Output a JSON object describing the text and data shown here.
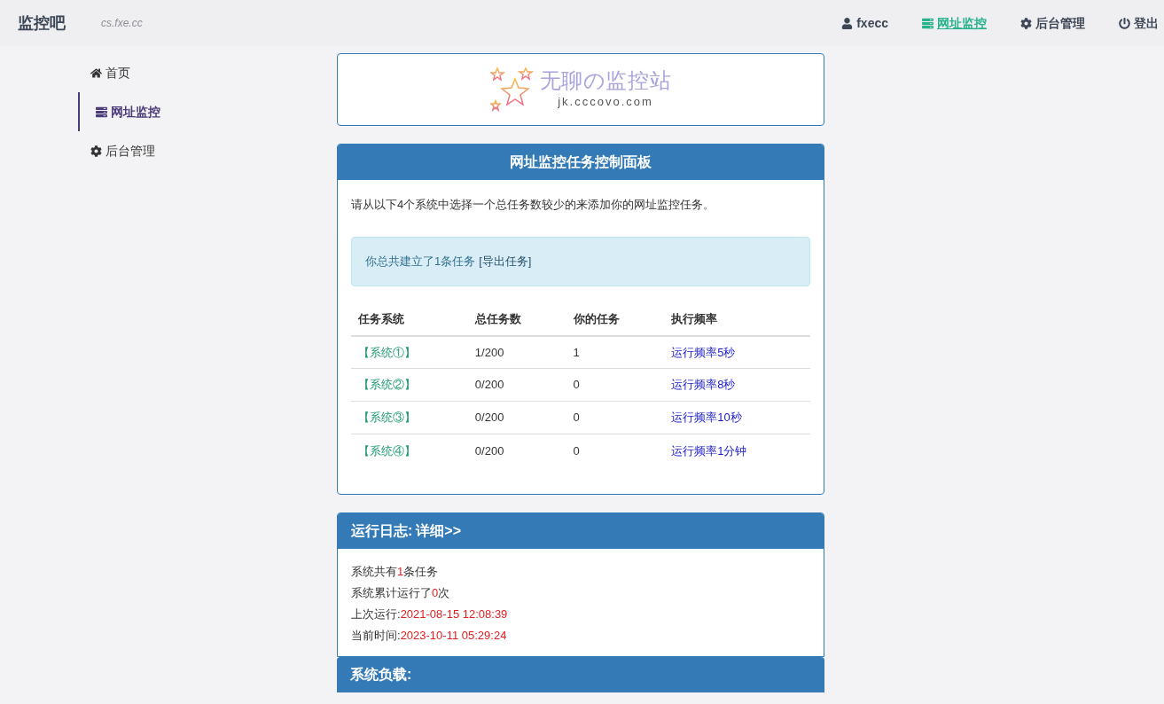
{
  "header": {
    "brand": "监控吧",
    "domain": "cs.fxe.cc",
    "nav": [
      {
        "kind": "user",
        "label": "fxecc",
        "selected": false
      },
      {
        "kind": "monitor",
        "label": "网址监控",
        "selected": true
      },
      {
        "kind": "admin",
        "label": "后台管理",
        "selected": false
      },
      {
        "kind": "logout",
        "label": "登出",
        "selected": false
      }
    ]
  },
  "sidebar": {
    "items": [
      {
        "kind": "home",
        "label": "首页",
        "selected": false
      },
      {
        "kind": "monitor",
        "label": "网址监控",
        "selected": true
      },
      {
        "kind": "admin",
        "label": "后台管理",
        "selected": false
      }
    ]
  },
  "logo": {
    "title": "无聊の监控站",
    "url": "jk.cccovo.com"
  },
  "panel": {
    "title": "网址监控任务控制面板",
    "intro": "请从以下4个系统中选择一个总任务数较少的来添加你的网址监控任务。",
    "alert_text": "你总共建立了1条任务",
    "alert_link": "[导出任务]",
    "table": {
      "columns": [
        "任务系统",
        "总任务数",
        "你的任务",
        "执行频率"
      ],
      "rows": [
        [
          "【系统①】",
          "1/200",
          "1",
          "运行频率5秒"
        ],
        [
          "【系统②】",
          "0/200",
          "0",
          "运行频率8秒"
        ],
        [
          "【系统③】",
          "0/200",
          "0",
          "运行频率10秒"
        ],
        [
          "【系统④】",
          "0/200",
          "0",
          "运行频率1分钟"
        ]
      ]
    }
  },
  "log": {
    "title": "运行日志:",
    "link": "详细>>",
    "lines": [
      {
        "before": "系统共有",
        "value": "1",
        "after": "条任务"
      },
      {
        "before": "系统累计运行了",
        "value": "0",
        "after": "次"
      },
      {
        "before": "上次运行:",
        "value": "2021-08-15 12:08:39"
      },
      {
        "before": "当前时间:",
        "value": "2023-10-11 05:29:24"
      }
    ]
  },
  "load": {
    "title": "系统负载:"
  }
}
